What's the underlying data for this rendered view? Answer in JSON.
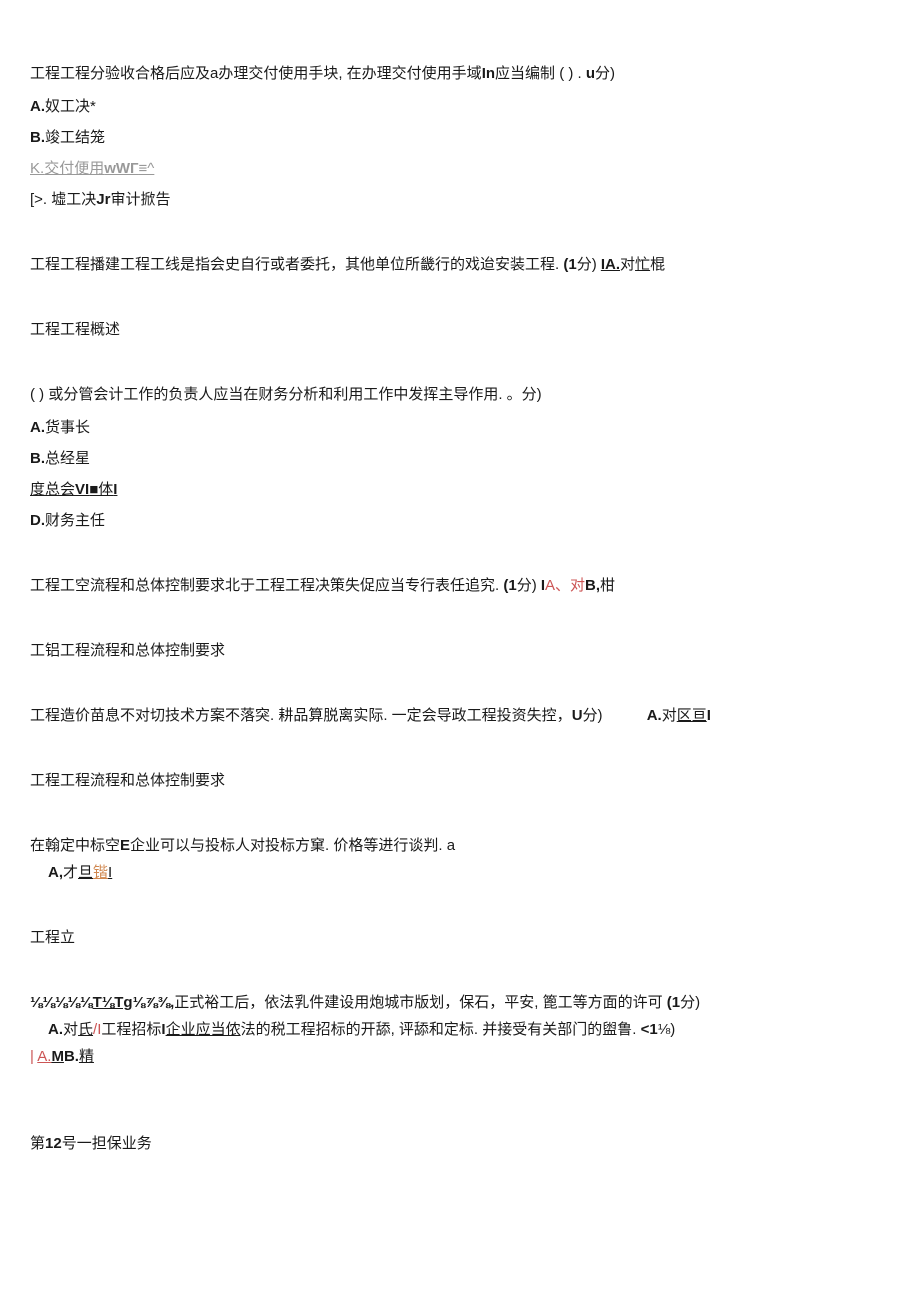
{
  "q1": {
    "question_pre": "工程工程分验收合格后应及a办理交付使用手块, 在办理交付使用手域",
    "question_bold1": "In",
    "question_mid": "应当编制 ( ) . ",
    "question_bold2": "u",
    "question_end": "分)",
    "optA_label": "A.",
    "optA_text": "奴工决*",
    "optB_label": "B.",
    "optB_text": "竣工结笼",
    "optK_pre": "K.",
    "optK_text": "交付便用",
    "optK_bold": "wWГ",
    "optK_end": "≡^",
    "optD_pre": "[>. 墟工决",
    "optD_bold": "Jr",
    "optD_end": "审计掀告"
  },
  "q2": {
    "text_pre": "工程工程播建工程工线是指会史自行或者委托，其他单位所畿行的戏迨安装工程.  ",
    "score_bold": "(1",
    "score_text": "分)",
    "ans_bold": "IA.",
    "ans_text": "对",
    "ans_underline": "忙",
    "ans_end": "棍"
  },
  "q3_header": "工程工程概述",
  "q3": {
    "question": " ( ) 或分管会计工作的负责人应当在财务分析和利用工作中发挥主导作用. 。分)",
    "optA_label": "A.",
    "optA_text": "货事长",
    "optB_label": "B.",
    "optB_text": "总经星",
    "optC_pre": "度总会",
    "optC_bold1": "VI",
    "optC_mid": "■体",
    "optC_bold2": "I",
    "optD_label": "D.",
    "optD_text": "财务主任"
  },
  "q4": {
    "text": "工程工空流程和总体控制要求北于工程工程决策失促应当专行表任追究.  ",
    "score_bold": "(1",
    "score_text": "分)",
    "ans_pre": "I",
    "ans_red": "A、对",
    "ans_bold": "B,",
    "ans_end": "柑"
  },
  "q5_header": "工铝工程流程和总体控制要求",
  "q5": {
    "text": "工程造价苗息不对切技术方案不落突. 耕品算脱离实际. 一定会导政工程投资失控，",
    "score_bold": "U",
    "score_text": "分)",
    "ans_bold": "A.",
    "ans_text": "对",
    "ans_underline": "区亘",
    "ans_end": "I"
  },
  "q6_header": "工程工程流程和总体控制要求",
  "q6": {
    "text_pre": "在翰定中标空",
    "text_bold": "E",
    "text_end": "企业可以与投标人对投标方窠. 价格等进行谈判. a",
    "ans_bold": "A,",
    "ans_text": "才",
    "ans_underline": "旦",
    "ans_orange": "锴",
    "ans_end": "I"
  },
  "q7_header": "工程立",
  "q7": {
    "line1_pre": "⅛⅛⅛⅛⅛",
    "line1_underline": "T⅛Tg",
    "line1_bold": "⅛⅞⅜,",
    "line1_text": "正式裕工后，依法乳件建设用炮城市版划，保石，平安, 篦工等方面的许可 ",
    "line1_score": "(1",
    "line1_score_text": "分)",
    "line2_bold1": "A.",
    "line2_text1": "对",
    "line2_underline1": "氏",
    "line2_red": "/I",
    "line2_text2": "工程招标",
    "line2_bold2": "I",
    "line2_underline2": "企业应当侬",
    "line2_text3": "法的税工程招标的开舔, 评舔和定标. 并接受有关部门的盥鲁. ",
    "line2_score": "<1",
    "line2_score_text": "⅛)",
    "line3_pre": "| ",
    "line3_underline1": "A.",
    "line3_bold": "M",
    "line3_text": "B.",
    "line3_underline2": "精"
  },
  "q8_header_pre": "第",
  "q8_header_bold": "12",
  "q8_header_text": "号一担保业务"
}
